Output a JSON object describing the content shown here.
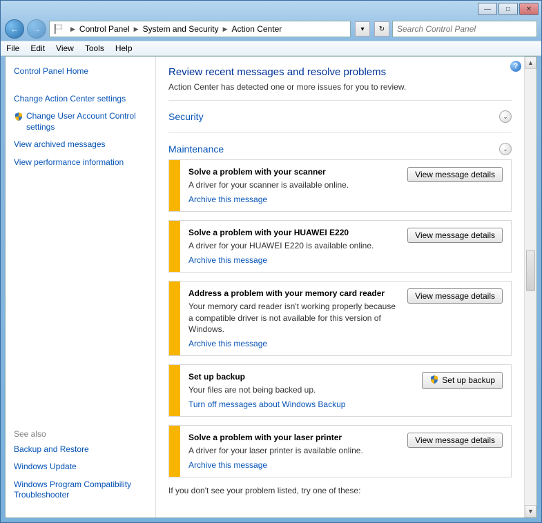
{
  "titlebar": {
    "min": "—",
    "max": "□",
    "close": "✕"
  },
  "nav": {
    "back": "←",
    "forward": "→"
  },
  "breadcrumbs": [
    "Control Panel",
    "System and Security",
    "Action Center"
  ],
  "search": {
    "placeholder": "Search Control Panel"
  },
  "menu": {
    "file": "File",
    "edit": "Edit",
    "view": "View",
    "tools": "Tools",
    "help": "Help"
  },
  "sidebar": {
    "home": "Control Panel Home",
    "change_ac": "Change Action Center settings",
    "change_uac": "Change User Account Control settings",
    "archived": "View archived messages",
    "perf": "View performance information",
    "see_also_hdr": "See also",
    "backup_restore": "Backup and Restore",
    "windows_update": "Windows Update",
    "compat": "Windows Program Compatibility Troubleshooter"
  },
  "main": {
    "heading": "Review recent messages and resolve problems",
    "sub": "Action Center has detected one or more issues for you to review.",
    "security_hdr": "Security",
    "maintenance_hdr": "Maintenance",
    "footer": "If you don't see your problem listed, try one of these:"
  },
  "messages": [
    {
      "title": "Solve a problem with your scanner",
      "desc": "A driver for your scanner is available online.",
      "link": "Archive this message",
      "button": "View message details",
      "button_icon": false
    },
    {
      "title": "Solve a problem with your HUAWEI E220",
      "desc": "A driver for your HUAWEI E220 is available online.",
      "link": "Archive this message",
      "button": "View message details",
      "button_icon": false
    },
    {
      "title": "Address a problem with your memory card reader",
      "desc": "Your memory card reader isn't working properly because a compatible driver is not available for this version of Windows.",
      "link": "Archive this message",
      "button": "View message details",
      "button_icon": false
    },
    {
      "title": "Set up backup",
      "desc": "Your files are not being backed up.",
      "link": "Turn off messages about Windows Backup",
      "button": "Set up backup",
      "button_icon": true
    },
    {
      "title": "Solve a problem with your laser printer",
      "desc": "A driver for your laser printer is available online.",
      "link": "Archive this message",
      "button": "View message details",
      "button_icon": false
    }
  ]
}
